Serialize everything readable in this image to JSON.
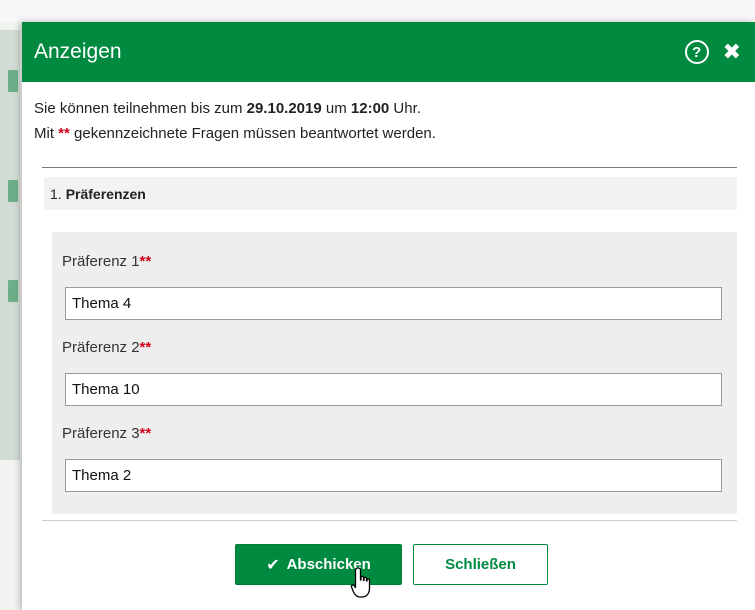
{
  "modal": {
    "title": "Anzeigen",
    "help_icon_glyph": "?",
    "close_icon_glyph": "✖"
  },
  "intro": {
    "line1_prefix": "Sie können teilnehmen bis zum ",
    "deadline_date": "29.10.2019",
    "line1_middle": " um ",
    "deadline_time": "12:00",
    "line1_suffix": " Uhr.",
    "line2_prefix": "Mit ",
    "required_marker": "**",
    "line2_suffix": " gekennzeichnete Fragen müssen beantwortet werden."
  },
  "section": {
    "number": "1.",
    "title": "Präferenzen"
  },
  "fields": [
    {
      "label": "Präferenz 1",
      "required": "**",
      "value": "Thema 4"
    },
    {
      "label": "Präferenz 2",
      "required": "**",
      "value": "Thema 10"
    },
    {
      "label": "Präferenz 3",
      "required": "**",
      "value": "Thema 2"
    }
  ],
  "buttons": {
    "submit_label": "Abschicken",
    "submit_icon": "check-icon",
    "close_label": "Schließen"
  },
  "colors": {
    "accent": "#008a40",
    "required": "#d0021b"
  }
}
